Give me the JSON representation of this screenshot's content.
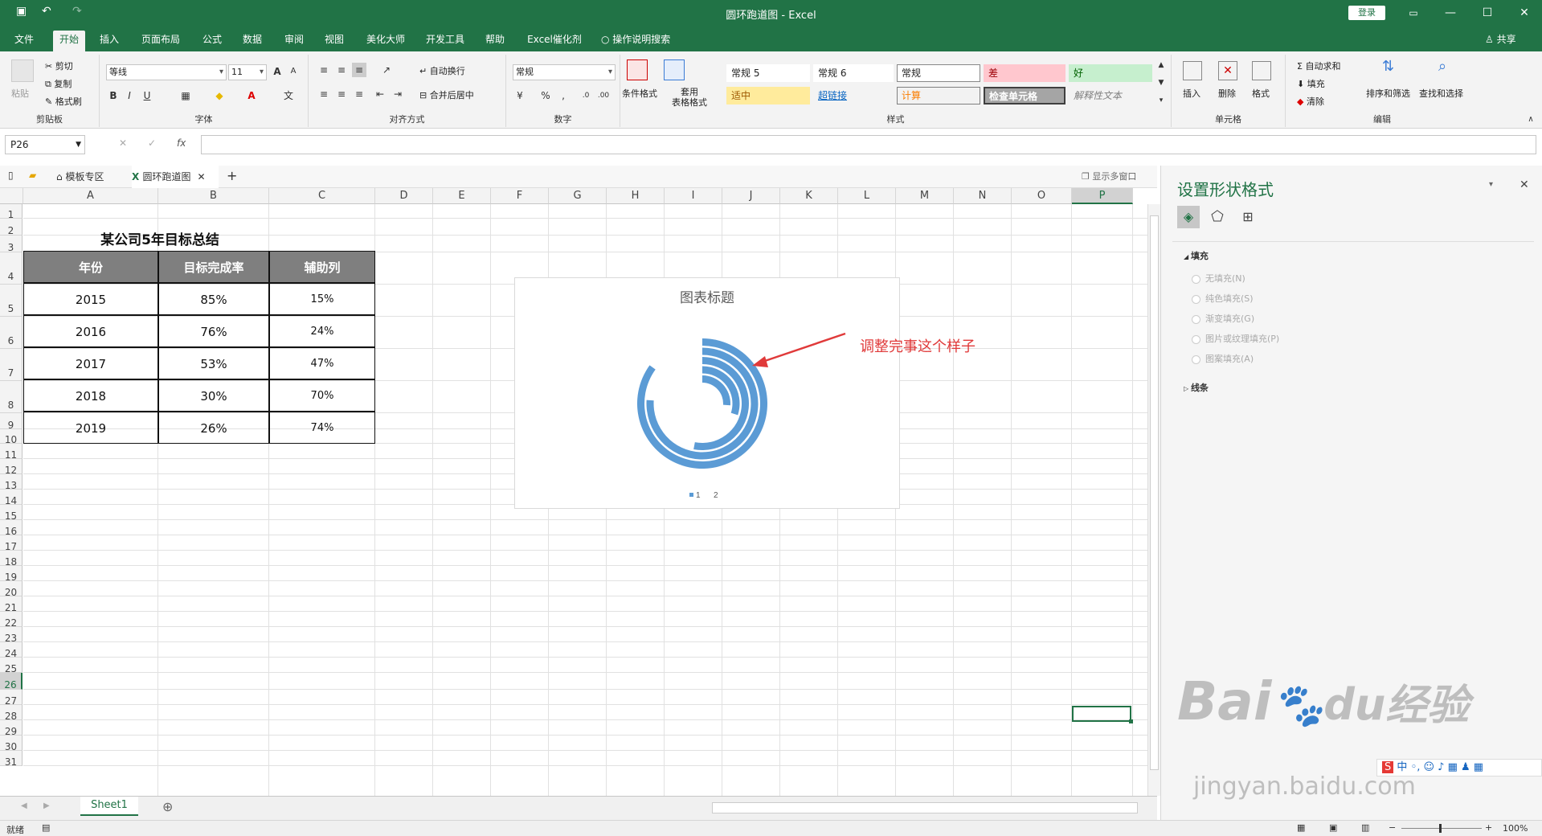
{
  "titlebar": {
    "title": "圆环跑道图  -  Excel",
    "login": "登录",
    "undo": "↶",
    "redo": "↷",
    "save": "▣",
    "minimize": "—",
    "restore": "☐",
    "close": "✕",
    "ribbon_opts": "▭"
  },
  "menu": {
    "tabs": [
      "文件",
      "开始",
      "插入",
      "页面布局",
      "公式",
      "数据",
      "审阅",
      "视图",
      "美化大师",
      "开发工具",
      "帮助",
      "Excel催化剂",
      "操作说明搜索"
    ],
    "share": "共享"
  },
  "ribbon": {
    "clipboard": {
      "paste": "粘贴",
      "cut": "剪切",
      "copy": "复制",
      "format_painter": "格式刷",
      "label": "剪贴板"
    },
    "font": {
      "name": "等线",
      "size": "11",
      "bold": "B",
      "italic": "I",
      "underline": "U",
      "grow": "A",
      "shrink": "A",
      "label": "字体"
    },
    "align": {
      "wrap": "自动换行",
      "merge": "合并后居中",
      "label": "对齐方式"
    },
    "number": {
      "format": "常规",
      "percent": "%",
      "comma": ",",
      "label": "数字"
    },
    "styles": {
      "conditional": "条件格式",
      "table_format": "套用\n表格格式",
      "cells": [
        "常规 5",
        "常规 6",
        "常规",
        "差",
        "好",
        "适中",
        "超链接",
        "计算",
        "检查单元格",
        "解释性文本"
      ],
      "label": "样式"
    },
    "cells": {
      "insert": "插入",
      "delete": "删除",
      "format": "格式",
      "label": "单元格"
    },
    "editing": {
      "autosum": "自动求和",
      "fill": "填充",
      "clear": "清除",
      "sort": "排序和筛选",
      "find": "查找和选择",
      "label": "编辑"
    }
  },
  "formula_bar": {
    "name_box": "P26",
    "cancel": "✕",
    "confirm": "✓",
    "fx": "fx",
    "value": ""
  },
  "doc_tabs": {
    "template_zone": "模板专区",
    "workbook": "圆环跑道图",
    "new_tab": "+",
    "multi_window": "显示多窗口"
  },
  "grid": {
    "columns": [
      "A",
      "B",
      "C",
      "D",
      "E",
      "F",
      "G",
      "H",
      "I",
      "J",
      "K",
      "L",
      "M",
      "N",
      "O",
      "P"
    ],
    "rows": [
      "1",
      "2",
      "3",
      "4",
      "5",
      "6",
      "7",
      "8",
      "9",
      "10",
      "11",
      "12",
      "13",
      "14",
      "15",
      "16",
      "17",
      "18",
      "19",
      "20",
      "21",
      "22",
      "23",
      "24",
      "25",
      "26",
      "27",
      "28",
      "29",
      "30",
      "31"
    ],
    "selected": "P26"
  },
  "table": {
    "title": "某公司5年目标总结",
    "headers": [
      "年份",
      "目标完成率",
      "辅助列"
    ],
    "rows": [
      [
        "2015",
        "85%",
        "15%"
      ],
      [
        "2016",
        "76%",
        "24%"
      ],
      [
        "2017",
        "53%",
        "47%"
      ],
      [
        "2018",
        "30%",
        "70%"
      ],
      [
        "2019",
        "26%",
        "74%"
      ]
    ]
  },
  "chart_data": {
    "type": "doughnut",
    "title": "图表标题",
    "series": [
      {
        "name": "1",
        "values": [
          0.85,
          0.76,
          0.53,
          0.3,
          0.26
        ]
      },
      {
        "name": "2",
        "values": [
          0.15,
          0.24,
          0.47,
          0.7,
          0.74
        ]
      }
    ],
    "series1_color": "#5b9bd5",
    "legend": [
      "1",
      "2"
    ],
    "legend_position": "bottom"
  },
  "annotation": {
    "text": "调整完事这个样子",
    "color": "#e03a3a"
  },
  "sheets": {
    "active": "Sheet1",
    "add": "⊕"
  },
  "status": {
    "ready": "就绪",
    "zoom": "100%"
  },
  "pane": {
    "title": "设置形状格式",
    "fill_section": "填充",
    "fill_options": [
      "无填充(N)",
      "纯色填充(S)",
      "渐变填充(G)",
      "图片或纹理填充(P)",
      "图案填充(A)"
    ],
    "line_section": "线条"
  },
  "watermark": {
    "brand": "Bai",
    "brand2": "经验",
    "url": "jingyan.baidu.com"
  },
  "ime_bar": {
    "text": "中"
  }
}
